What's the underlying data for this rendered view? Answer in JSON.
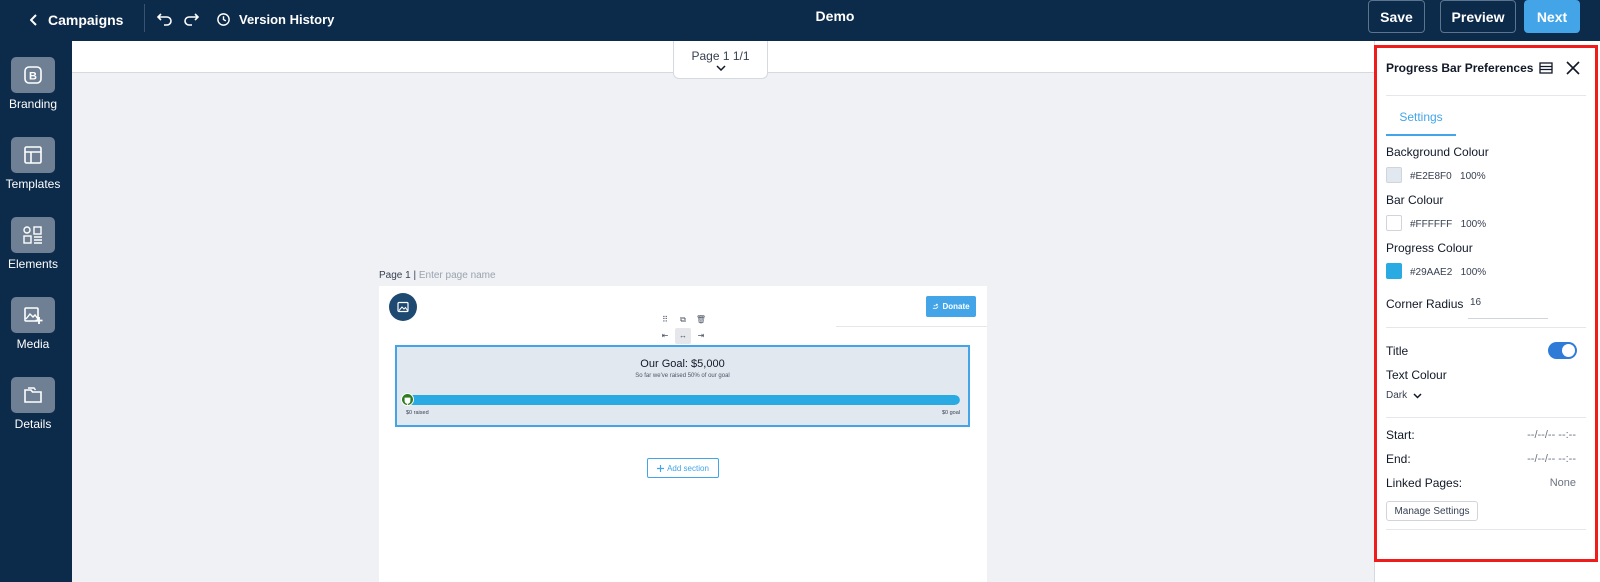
{
  "topbar": {
    "back_label": "Campaigns",
    "history_label": "Version History",
    "title": "Demo",
    "save_label": "Save",
    "preview_label": "Preview",
    "next_label": "Next"
  },
  "sidebar": {
    "items": [
      {
        "label": "Branding",
        "icon": "branding-icon"
      },
      {
        "label": "Templates",
        "icon": "templates-icon"
      },
      {
        "label": "Elements",
        "icon": "elements-icon"
      },
      {
        "label": "Media",
        "icon": "media-icon"
      },
      {
        "label": "Details",
        "icon": "details-icon"
      }
    ]
  },
  "page_indicator": "Page 1 1/1",
  "canvas": {
    "page_label": "Page 1 |",
    "page_name_placeholder": "Enter page name",
    "donate_label": "Donate",
    "add_section_label": "Add section",
    "progress": {
      "title": "Our Goal: $5,000",
      "subtitle": "So far we've raised 50% of our goal",
      "raised_label": "$0 raised",
      "goal_label": "$0 goal",
      "fill_fraction": 1.0
    }
  },
  "panel": {
    "title": "Progress Bar Preferences",
    "tab": "Settings",
    "background_colour": {
      "label": "Background Colour",
      "hex": "#E2E8F0",
      "opacity": "100%"
    },
    "bar_colour": {
      "label": "Bar Colour",
      "hex": "#FFFFFF",
      "opacity": "100%"
    },
    "progress_colour": {
      "label": "Progress Colour",
      "hex": "#29AAE2",
      "opacity": "100%"
    },
    "corner_radius": {
      "label": "Corner Radius",
      "value": "16"
    },
    "title_toggle": {
      "label": "Title",
      "on": true
    },
    "text_colour": {
      "label": "Text Colour",
      "value": "Dark"
    },
    "start": {
      "label": "Start:",
      "value": "--/--/-- --:--"
    },
    "end": {
      "label": "End:",
      "value": "--/--/-- --:--"
    },
    "linked_pages": {
      "label": "Linked Pages:",
      "value": "None"
    },
    "manage_label": "Manage Settings"
  },
  "colors": {
    "topbar_bg": "#0c2a4a",
    "accent": "#43a5e8",
    "highlight": "#f01c1c"
  }
}
